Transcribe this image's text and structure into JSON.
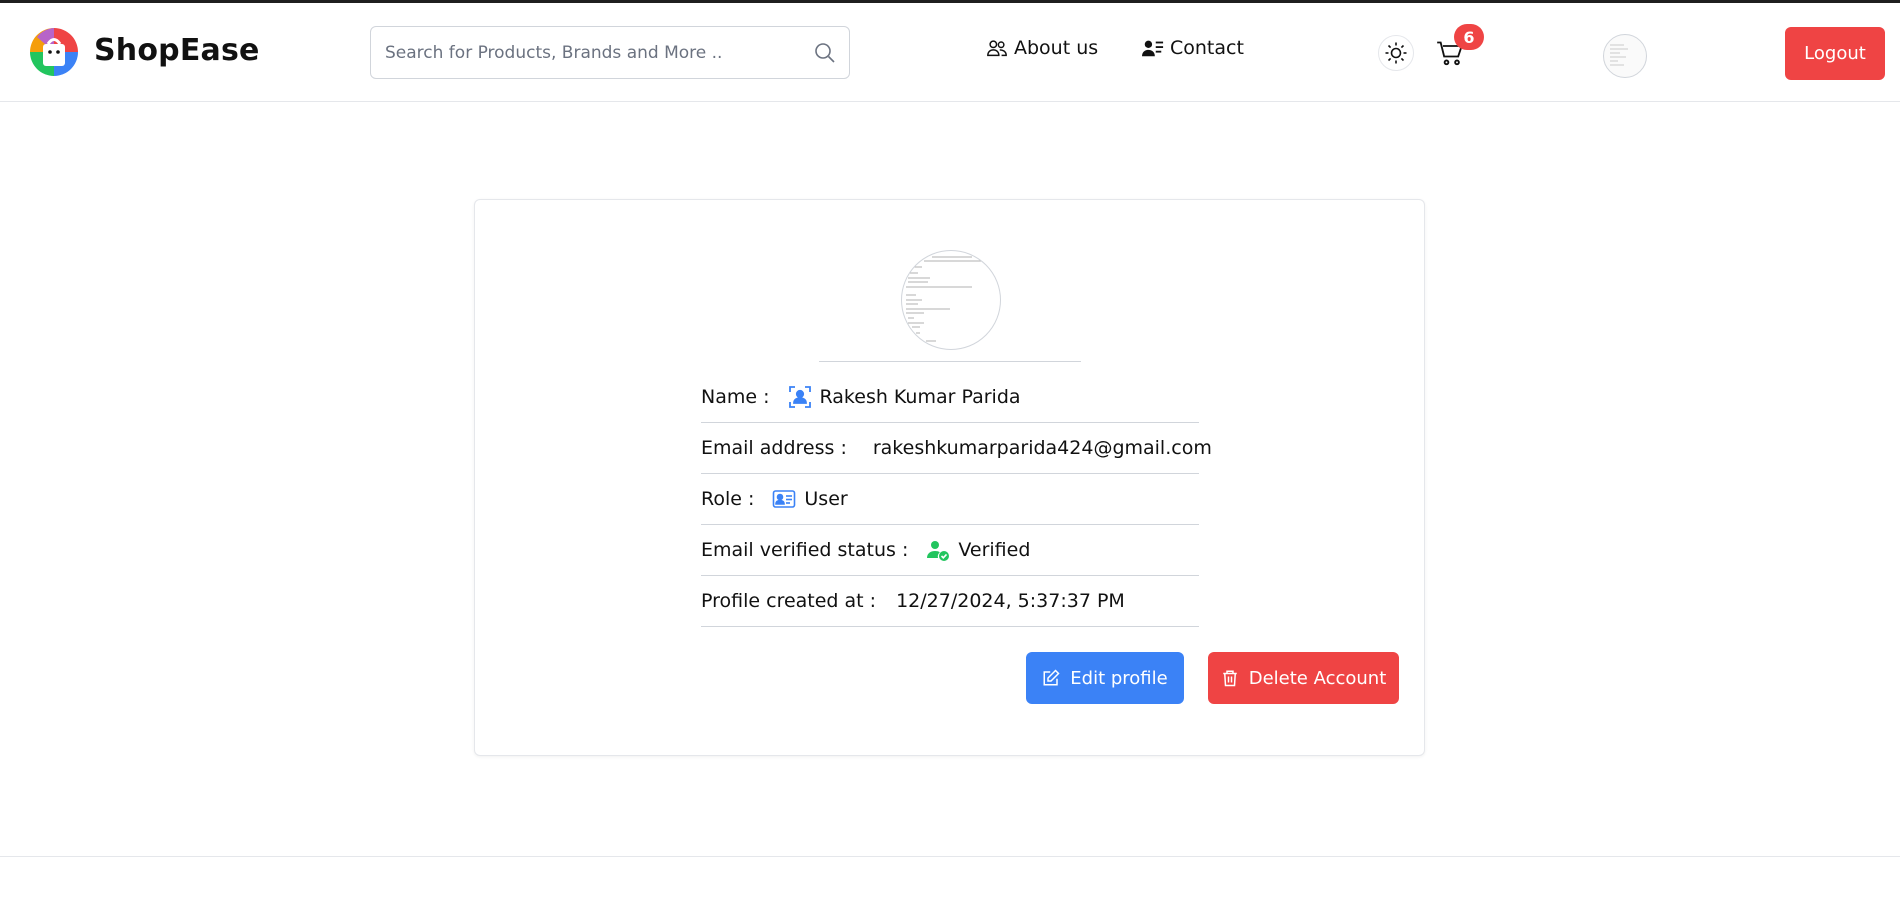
{
  "header": {
    "brand": "ShopEase",
    "search_placeholder": "Search for Products, Brands and More ..",
    "nav": {
      "about": "About us",
      "contact": "Contact"
    },
    "cart_count": "6",
    "logout_label": "Logout"
  },
  "profile": {
    "rows": [
      {
        "label": "Name :",
        "value": "Rakesh Kumar  Parida",
        "icon": "user-scan-icon"
      },
      {
        "label": "Email address :",
        "value": "rakeshkumarparida424@gmail.com",
        "icon": "mail-at-icon"
      },
      {
        "label": "Role :",
        "value": "User",
        "icon": "id-card-icon"
      },
      {
        "label": "Email verified status :",
        "value": "Verified",
        "icon": "user-check-icon"
      },
      {
        "label": "Profile created at :",
        "value": "12/27/2024, 5:37:37 PM",
        "icon": ""
      }
    ],
    "edit_label": "Edit profile",
    "delete_label": "Delete Account"
  },
  "colors": {
    "accent_blue": "#3b82f6",
    "danger_red": "#ef4444",
    "verified_green": "#22c55e"
  }
}
